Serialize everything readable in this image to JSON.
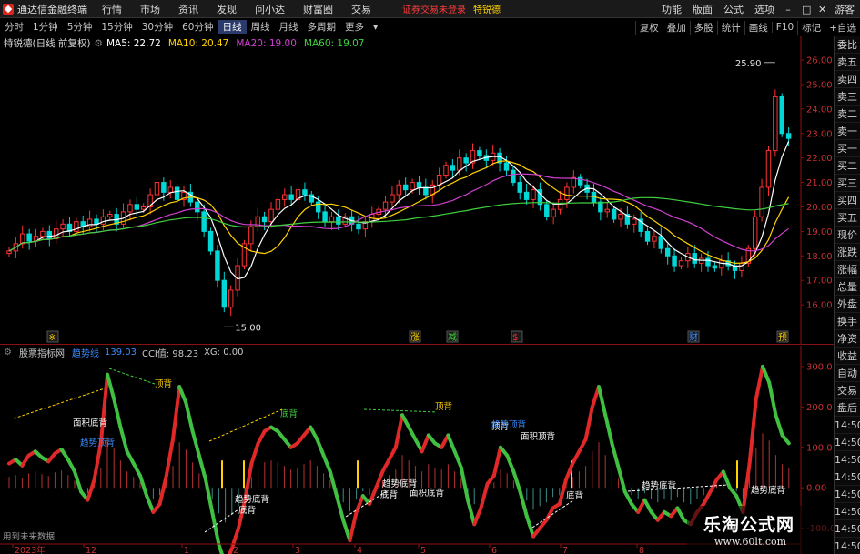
{
  "menubar": {
    "app_title": "通达信金融终端",
    "items": [
      "行情",
      "市场",
      "资讯",
      "发现",
      "问小达",
      "财富圈",
      "交易"
    ],
    "login_status": "证券交易未登录",
    "stock_label": "特锐德",
    "right_items": [
      "功能",
      "版面",
      "公式",
      "选项"
    ],
    "user": "游客"
  },
  "periodbar": {
    "periods": [
      "分时",
      "1分钟",
      "5分钟",
      "15分钟",
      "30分钟",
      "60分钟",
      "日线",
      "周线",
      "月线",
      "多周期",
      "更多"
    ],
    "active_period": "日线",
    "tools": [
      "复权",
      "叠加",
      "多股",
      "统计",
      "画线",
      "F10",
      "标记",
      "+自选"
    ]
  },
  "info": {
    "stock_title": "特锐德(日线 前复权)",
    "ma5": "MA5: 22.72",
    "ma10": "MA10: 20.47",
    "ma20": "MA20: 19.00",
    "ma60": "MA60: 19.07"
  },
  "indicator": {
    "name": "股票指标网",
    "trend_label": "趋势线",
    "trend_value": "139.03",
    "cci": "CCI值: 98.23",
    "xg": "XG: 0.00"
  },
  "future_hint": "用到未来数据",
  "sidepanel": {
    "quote_items": [
      "委比",
      "卖五",
      "卖四",
      "卖三",
      "卖二",
      "卖一",
      "买一",
      "买二",
      "买三",
      "买四",
      "买五",
      "现价",
      "涨跌",
      "涨幅",
      "总量",
      "外盘",
      "换手",
      "净资",
      "收益"
    ],
    "lower_items": [
      "自动",
      "交易",
      "盘后",
      "14:50",
      "14:50",
      "14:50",
      "14:50",
      "14:50",
      "14:50",
      "14:50",
      "14:50"
    ]
  },
  "watermark": {
    "title": "乐淘公式网",
    "url": "www.60lt.com"
  },
  "chart_data": [
    {
      "type": "candlestick",
      "title": "特锐德(日线 前复权)",
      "ylim": [
        15.0,
        26.3
      ],
      "y_ticks": [
        "26.00",
        "25.00",
        "24.00",
        "23.00",
        "22.00",
        "21.00",
        "20.00",
        "19.00",
        "18.00",
        "17.00",
        "16.00"
      ],
      "annotations": [
        {
          "label": "25.90",
          "kind": "high"
        },
        {
          "label": "15.00",
          "kind": "low"
        }
      ],
      "event_markers": [
        "※",
        "涨",
        "减",
        "$",
        "财",
        "预"
      ],
      "close": [
        18.2,
        18.5,
        18.9,
        18.6,
        18.8,
        19.0,
        18.7,
        19.1,
        19.3,
        19.0,
        19.4,
        19.2,
        19.5,
        19.3,
        19.6,
        19.7,
        19.3,
        19.8,
        20.1,
        19.9,
        20.0,
        20.5,
        21.0,
        20.6,
        20.8,
        20.3,
        20.6,
        20.2,
        19.8,
        19.0,
        18.2,
        17.0,
        15.9,
        16.6,
        17.6,
        18.5,
        19.2,
        19.6,
        19.4,
        19.9,
        20.3,
        20.5,
        20.3,
        20.7,
        20.5,
        20.2,
        19.8,
        19.4,
        19.6,
        19.3,
        19.6,
        19.3,
        19.1,
        19.4,
        19.7,
        19.9,
        20.2,
        20.5,
        20.9,
        20.7,
        21.0,
        20.8,
        20.5,
        20.9,
        21.3,
        21.7,
        21.5,
        22.0,
        21.8,
        22.3,
        22.1,
        21.9,
        22.2,
        21.8,
        21.5,
        21.0,
        20.6,
        20.3,
        20.7,
        20.1,
        19.6,
        19.9,
        20.3,
        20.8,
        21.2,
        20.9,
        20.6,
        20.2,
        19.8,
        19.9,
        19.5,
        19.7,
        19.3,
        19.5,
        19.0,
        18.6,
        18.8,
        18.3,
        18.0,
        17.6,
        17.8,
        18.1,
        17.7,
        17.9,
        17.6,
        17.5,
        17.8,
        17.6,
        17.4,
        17.7,
        18.3,
        19.6,
        20.8,
        22.3,
        24.5,
        23.0,
        22.8
      ],
      "series": [
        {
          "name": "MA5",
          "value": 22.72,
          "color": "#ffffff"
        },
        {
          "name": "MA10",
          "value": 20.47,
          "color": "#ffd200"
        },
        {
          "name": "MA20",
          "value": 19.0,
          "color": "#d040d0"
        },
        {
          "name": "MA60",
          "value": 19.07,
          "color": "#40d040"
        }
      ],
      "x_tick_labels": [
        "2023年",
        "12",
        "1",
        "2",
        "3",
        "4",
        "5",
        "6",
        "7",
        "8"
      ]
    },
    {
      "type": "bar",
      "title": "股票指标网",
      "ylim": [
        -130,
        320
      ],
      "y_ticks": [
        "300.0",
        "200.0",
        "100.0",
        "0.00",
        "-100.0"
      ],
      "cci": [
        60,
        70,
        55,
        80,
        90,
        75,
        65,
        85,
        95,
        70,
        40,
        -10,
        -30,
        20,
        110,
        280,
        220,
        150,
        90,
        60,
        30,
        -20,
        -60,
        -40,
        30,
        120,
        250,
        210,
        140,
        80,
        20,
        -60,
        -140,
        -190,
        -150,
        -100,
        -30,
        60,
        110,
        140,
        150,
        140,
        120,
        100,
        110,
        130,
        150,
        120,
        80,
        40,
        -20,
        -80,
        -130,
        -60,
        -20,
        -40,
        0,
        40,
        70,
        100,
        180,
        150,
        120,
        90,
        130,
        110,
        100,
        130,
        90,
        50,
        -30,
        -90,
        -50,
        10,
        30,
        100,
        80,
        40,
        -10,
        -70,
        -120,
        -100,
        -80,
        -50,
        -40,
        20,
        60,
        90,
        120,
        200,
        250,
        180,
        110,
        50,
        -10,
        -40,
        -60,
        -30,
        -60,
        -80,
        -60,
        -70,
        -50,
        -80,
        -90,
        -60,
        -40,
        -10,
        20,
        40,
        0,
        -20,
        -60,
        60,
        220,
        300,
        260,
        180,
        130,
        110
      ],
      "trend_labels": [
        "顶背",
        "底背",
        "顶背",
        "面积底背",
        "趋势顶背",
        "趋势底背",
        "底背",
        "趋势底背",
        "底背",
        "面积底背",
        "顶背",
        "面积顶背",
        "趋势顶背",
        "底背",
        "趋势底背",
        "趋势底背"
      ]
    }
  ]
}
